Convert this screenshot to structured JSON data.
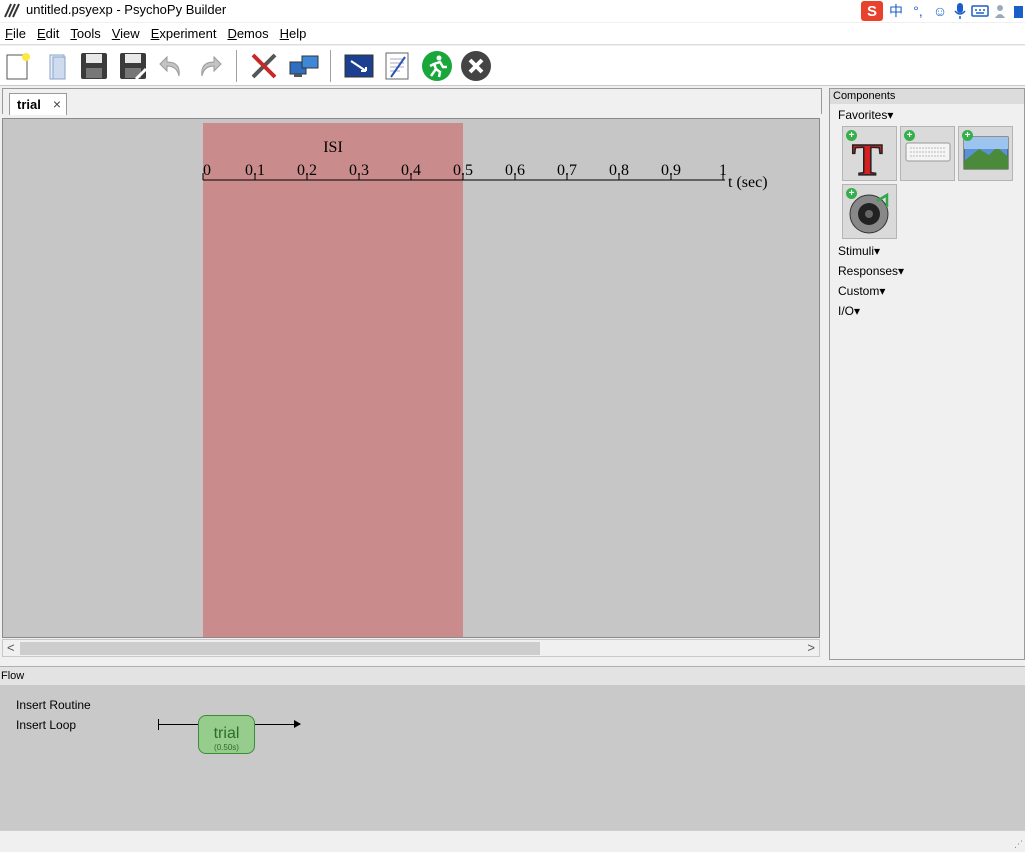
{
  "window": {
    "title": "untitled.psyexp - PsychoPy Builder"
  },
  "tray": {
    "items": [
      "ime-logo-icon",
      "中",
      "°,",
      "smile-icon",
      "mic-icon",
      "keyboard-icon",
      "user-icon",
      "shirt-icon"
    ]
  },
  "menu": [
    {
      "accel": "F",
      "rest": "ile"
    },
    {
      "accel": "E",
      "rest": "dit"
    },
    {
      "accel": "T",
      "rest": "ools"
    },
    {
      "accel": "V",
      "rest": "iew"
    },
    {
      "accel": "E",
      "rest": "xperiment"
    },
    {
      "accel": "D",
      "rest": "emos"
    },
    {
      "accel": "H",
      "rest": "elp"
    }
  ],
  "toolbar": {
    "buttons": [
      "new-file-icon",
      "open-file-icon",
      "save-icon",
      "save-as-icon",
      "undo-icon",
      "redo-icon",
      "preferences-icon",
      "monitor-center-icon",
      "compile-script-icon",
      "experiment-settings-icon",
      "run-icon",
      "stop-icon"
    ]
  },
  "routine": {
    "tab_label": "trial",
    "tab_close": "×",
    "component_name": "ISI",
    "component_start": 0,
    "component_stop": 0.5,
    "timeline": {
      "min": 0,
      "max": 1,
      "ticks": [
        "0",
        "0.1",
        "0.2",
        "0.3",
        "0.4",
        "0.5",
        "0.6",
        "0.7",
        "0.8",
        "0.9",
        "1"
      ],
      "unit_label": "t (sec)"
    },
    "component_color": "#c98b8b",
    "scroll_left": "<",
    "scroll_right": ">"
  },
  "components": {
    "header": "Components",
    "favorites_label": "Favorites",
    "favorites": [
      "text-component-icon",
      "keyboard-component-icon",
      "image-component-icon",
      "sound-component-icon"
    ],
    "categories": [
      "Stimuli",
      "Responses",
      "Custom",
      "I/O"
    ],
    "dropdown_glyph": "▾"
  },
  "flow": {
    "header": "Flow",
    "insert_routine": "Insert Routine",
    "insert_loop": "Insert Loop",
    "routine_name": "trial",
    "routine_duration": "(0.50s)"
  },
  "statusbar": {
    "grip": "⋰"
  }
}
